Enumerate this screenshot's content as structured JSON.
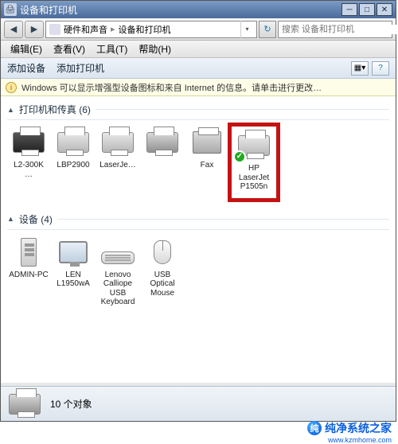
{
  "window": {
    "title": "设备和打印机"
  },
  "winbtns": {
    "min": "─",
    "max": "□",
    "close": "✕"
  },
  "nav": {
    "back": "◀",
    "fwd": "▶",
    "refresh": "↻"
  },
  "breadcrumb": {
    "part1": "硬件和声音",
    "part2": "设备和打印机"
  },
  "search": {
    "placeholder": "搜索 设备和打印机"
  },
  "menu": {
    "edit": "编辑(E)",
    "view": "查看(V)",
    "tools": "工具(T)",
    "help": "帮助(H)"
  },
  "toolbar": {
    "add_device": "添加设备",
    "add_printer": "添加打印机"
  },
  "infobar": {
    "text": "Windows 可以显示增强型设备图标和来自 Internet 的信息。请单击进行更改…"
  },
  "groups": {
    "printers": {
      "label": "打印机和传真 (6)"
    },
    "devices": {
      "label": "设备 (4)"
    }
  },
  "printers": [
    {
      "name": "L2-300K …"
    },
    {
      "name": "LBP2900"
    },
    {
      "name": "LaserJe…"
    },
    {
      "name": ""
    },
    {
      "name": "Fax"
    },
    {
      "name": "HP LaserJet P1505n",
      "default": true
    }
  ],
  "devices": [
    {
      "name": "ADMIN-PC"
    },
    {
      "name": "LEN L1950wA"
    },
    {
      "name": "Lenovo Calliope USB Keyboard"
    },
    {
      "name": "USB Optical Mouse"
    }
  ],
  "status": {
    "count_text": "10 个对象"
  },
  "watermark": {
    "brand": "纯净系统之家",
    "url": "www.kzmhome.com"
  }
}
